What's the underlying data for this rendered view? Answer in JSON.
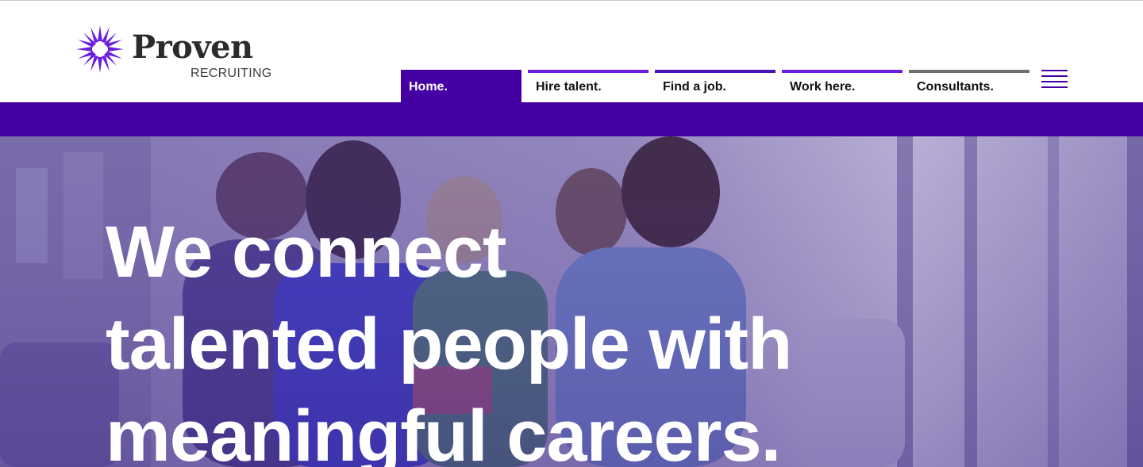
{
  "header": {
    "logo": {
      "wordmark": "Proven",
      "subtitle": "RECRUITING",
      "brand_color": "#6a1fe0"
    }
  },
  "nav": {
    "items": [
      {
        "label": "Home.",
        "active": true,
        "accent": "#4400a3"
      },
      {
        "label": "Hire talent.",
        "active": false,
        "accent": "#6a1fe0"
      },
      {
        "label": "Find a job.",
        "active": false,
        "accent": "#4b12b8"
      },
      {
        "label": "Work here.",
        "active": false,
        "accent": "#6a1fe0"
      },
      {
        "label": "Consultants.",
        "active": false,
        "accent": "#6e6e6e"
      }
    ],
    "menu_icon": "hamburger-menu-icon"
  },
  "hero": {
    "headline_lines": [
      "We connect",
      "talented people with",
      "meaningful careers."
    ],
    "overlay_color": "#6a4ab0"
  },
  "colors": {
    "primary": "#4400a3",
    "accent": "#6a1fe0",
    "text": "#111111"
  }
}
